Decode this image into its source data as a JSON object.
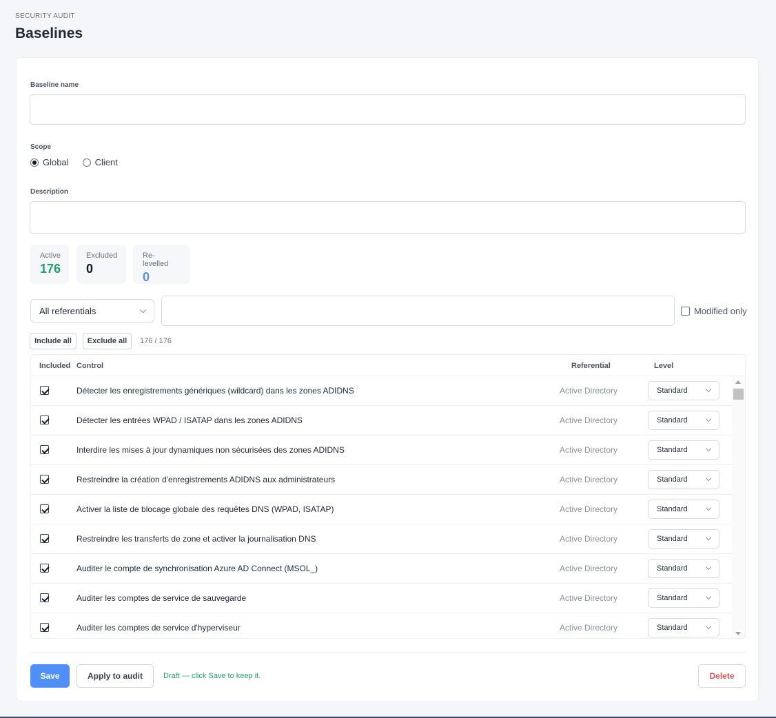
{
  "header": {
    "eyebrow": "SECURITY AUDIT",
    "title": "Baselines"
  },
  "form": {
    "name_label": "Baseline name",
    "name_value": "",
    "scope_label": "Scope",
    "scope_options": [
      {
        "label": "Global",
        "selected": true
      },
      {
        "label": "Client",
        "selected": false
      }
    ],
    "description_label": "Description",
    "description_value": ""
  },
  "stats": {
    "active": {
      "label": "Active",
      "value": "176",
      "color": "#22a06b"
    },
    "excluded": {
      "label": "Excluded",
      "value": "0",
      "color": "#111827"
    },
    "relevelled": {
      "label": "Re-levelled",
      "value": "0",
      "color": "#5b8fd6"
    }
  },
  "filters": {
    "referential_selected": "All referentials",
    "search_value": "",
    "modified_only_label": "Modified only",
    "modified_only_checked": false
  },
  "bulk": {
    "include_all": "Include all",
    "exclude_all": "Exclude all",
    "count": "176 / 176"
  },
  "table": {
    "columns": {
      "included": "Included",
      "control": "Control",
      "referential": "Referential",
      "level": "Level"
    },
    "rows": [
      {
        "included": true,
        "control": "Détecter les enregistrements génériques (wildcard) dans les zones ADIDNS",
        "referential": "Active Directory",
        "level": "Standard"
      },
      {
        "included": true,
        "control": "Détecter les entrées WPAD / ISATAP dans les zones ADIDNS",
        "referential": "Active Directory",
        "level": "Standard"
      },
      {
        "included": true,
        "control": "Interdire les mises à jour dynamiques non sécurisées des zones ADIDNS",
        "referential": "Active Directory",
        "level": "Standard"
      },
      {
        "included": true,
        "control": "Restreindre la création d'enregistrements ADIDNS aux administrateurs",
        "referential": "Active Directory",
        "level": "Standard"
      },
      {
        "included": true,
        "control": "Activer la liste de blocage globale des requêtes DNS (WPAD, ISATAP)",
        "referential": "Active Directory",
        "level": "Standard"
      },
      {
        "included": true,
        "control": "Restreindre les transferts de zone et activer la journalisation DNS",
        "referential": "Active Directory",
        "level": "Standard"
      },
      {
        "included": true,
        "control": "Auditer le compte de synchronisation Azure AD Connect (MSOL_)",
        "referential": "Active Directory",
        "level": "Standard"
      },
      {
        "included": true,
        "control": "Auditer les comptes de service de sauvegarde",
        "referential": "Active Directory",
        "level": "Standard"
      },
      {
        "included": true,
        "control": "Auditer les comptes de service d'hyperviseur",
        "referential": "Active Directory",
        "level": "Standard"
      }
    ]
  },
  "footer": {
    "save": "Save",
    "apply": "Apply to audit",
    "draft_note": "Draft — click Save to keep it.",
    "delete": "Delete"
  }
}
